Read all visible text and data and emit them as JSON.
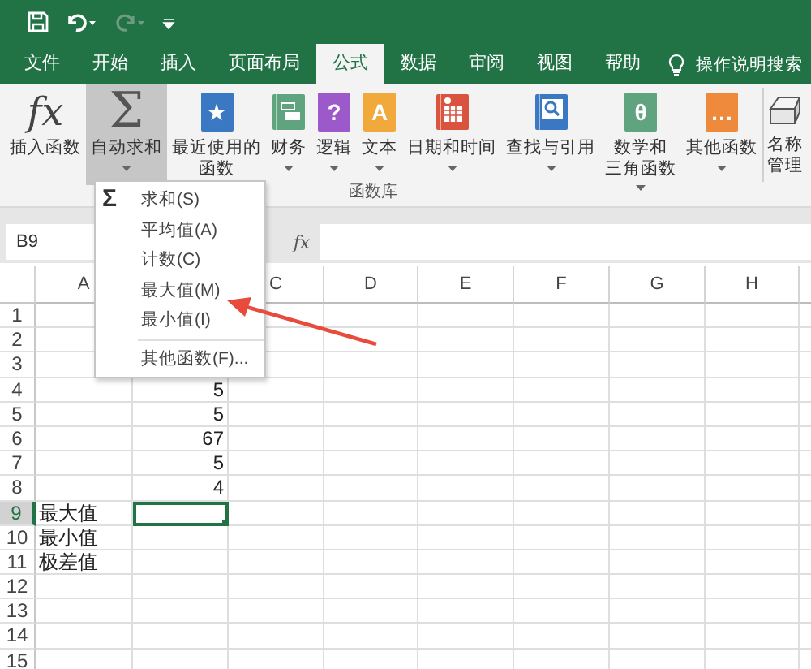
{
  "quick_access": [
    {
      "kind": "save",
      "disabled": false
    },
    {
      "kind": "undo",
      "disabled": false
    },
    {
      "kind": "redo",
      "disabled": true
    },
    {
      "kind": "customize",
      "disabled": false
    }
  ],
  "tabs": [
    {
      "label": "文件",
      "selected": false
    },
    {
      "label": "开始",
      "selected": false
    },
    {
      "label": "插入",
      "selected": false
    },
    {
      "label": "页面布局",
      "selected": false
    },
    {
      "label": "公式",
      "selected": true
    },
    {
      "label": "数据",
      "selected": false
    },
    {
      "label": "审阅",
      "selected": false
    },
    {
      "label": "视图",
      "selected": false
    },
    {
      "label": "帮助",
      "selected": false
    }
  ],
  "tell_me": "操作说明搜索",
  "ribbon": {
    "buttons": [
      {
        "kind": "glyph",
        "glyph": "fx",
        "lines": [
          "插入函数"
        ],
        "dropdown": false,
        "pressed": false
      },
      {
        "kind": "glyph",
        "glyph": "Σ",
        "lines": [
          "自动求和"
        ],
        "dropdown": true,
        "pressed": true
      },
      {
        "kind": "book",
        "glyph": "★",
        "color": "#3a78c3",
        "lines": [
          "最近使用的",
          "函数"
        ],
        "dropdown": true,
        "pressed": false
      },
      {
        "kind": "money",
        "color": "#5fa47e",
        "lines": [
          "财务"
        ],
        "dropdown": true,
        "pressed": false
      },
      {
        "kind": "book",
        "glyph": "?",
        "color": "#9b59c9",
        "lines": [
          "逻辑"
        ],
        "dropdown": true,
        "pressed": false
      },
      {
        "kind": "book",
        "glyph": "A",
        "color": "#f2a93b",
        "lines": [
          "文本"
        ],
        "dropdown": true,
        "pressed": false
      },
      {
        "kind": "calendar",
        "color": "#d9533f",
        "lines": [
          "日期和时间"
        ],
        "dropdown": true,
        "pressed": false
      },
      {
        "kind": "lookup",
        "color": "#3a78c3",
        "lines": [
          "查找与引用"
        ],
        "dropdown": true,
        "pressed": false
      },
      {
        "kind": "book",
        "glyph": "θ",
        "color": "#5fa47e",
        "lines": [
          "数学和",
          "三角函数"
        ],
        "dropdown": true,
        "pressed": false
      },
      {
        "kind": "book",
        "glyph": "…",
        "color": "#ef8a3c",
        "lines": [
          "其他函数"
        ],
        "dropdown": true,
        "pressed": false
      }
    ],
    "group_label": "函数库",
    "extra": {
      "kind": "names",
      "lines": [
        "名称",
        "管理"
      ]
    }
  },
  "formula_bar": {
    "name_box": "B9",
    "fx": "fx"
  },
  "sheet": {
    "columns": [
      {
        "label": "A"
      },
      {},
      {
        "label": "C"
      },
      {
        "label": "D"
      },
      {
        "label": "E"
      },
      {
        "label": "F"
      },
      {
        "label": "G"
      },
      {
        "label": "H"
      }
    ],
    "rows": [
      {
        "header": "1",
        "cells": [
          {
            "selected": false
          }
        ]
      },
      {
        "header": "2",
        "cells": [
          {
            "selected": false
          }
        ]
      },
      {
        "header": "3",
        "cells": [
          {
            "selected": false
          }
        ]
      },
      {
        "header": "4",
        "cells": [
          {
            "selected": false
          },
          {
            "text": "5",
            "selected": false
          }
        ]
      },
      {
        "header": "5",
        "cells": [
          {
            "selected": false
          },
          {
            "text": "5",
            "selected": false
          }
        ]
      },
      {
        "header": "6",
        "cells": [
          {
            "selected": false
          },
          {
            "text": "67",
            "selected": false
          }
        ]
      },
      {
        "header": "7",
        "cells": [
          {
            "selected": false
          },
          {
            "text": "5",
            "selected": false
          }
        ]
      },
      {
        "header": "8",
        "cells": [
          {
            "selected": false
          },
          {
            "text": "4",
            "selected": false
          }
        ]
      },
      {
        "header": "9",
        "cells": [
          {
            "text": "最大值",
            "selected": false
          },
          {
            "selected": true
          }
        ]
      },
      {
        "header": "10",
        "cells": [
          {
            "text": "最小值",
            "selected": false
          },
          {
            "selected": false
          }
        ]
      },
      {
        "header": "11",
        "cells": [
          {
            "text": "极差值",
            "selected": false
          },
          {
            "selected": false
          }
        ]
      },
      {
        "header": "12",
        "cells": [
          {
            "selected": false
          },
          {
            "selected": false
          }
        ]
      },
      {
        "header": "13",
        "cells": [
          {
            "selected": false
          },
          {
            "selected": false
          }
        ]
      },
      {
        "header": "14",
        "cells": [
          {
            "selected": false
          },
          {
            "selected": false
          }
        ]
      },
      {
        "header": "15",
        "cells": [
          {
            "selected": false
          },
          {
            "selected": false
          }
        ]
      }
    ]
  },
  "menu": {
    "items": [
      {
        "kind": "item",
        "label": "求和(S)",
        "glyph": "Σ"
      },
      {
        "kind": "item",
        "label": "平均值(A)"
      },
      {
        "kind": "item",
        "label": "计数(C)"
      },
      {
        "kind": "item",
        "label": "最大值(M)"
      },
      {
        "kind": "item",
        "label": "最小值(I)"
      },
      {
        "kind": "separator"
      },
      {
        "kind": "item",
        "label": "其他函数(F)..."
      }
    ]
  },
  "annotation": {
    "kind": "arrow"
  }
}
